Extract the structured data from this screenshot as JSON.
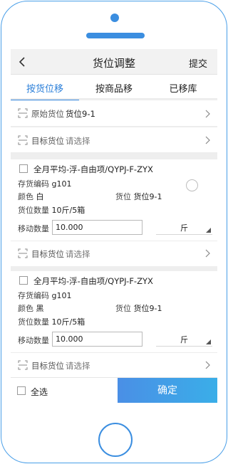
{
  "navbar": {
    "title": "货位调整",
    "submit_label": "提交"
  },
  "tabs": [
    {
      "label": "按货位移",
      "active": true
    },
    {
      "label": "按商品移",
      "active": false
    },
    {
      "label": "已移库",
      "active": false
    }
  ],
  "source_location": {
    "label": "原始货位",
    "value": "货位9-1"
  },
  "target_location": {
    "label": "目标货位",
    "placeholder": "请选择"
  },
  "items": [
    {
      "title": "全月平均-浮-自由项/QYPJ-F-ZYX",
      "code_label": "存货编码",
      "code_value": "g101",
      "color_label": "颜色",
      "color_value": "白",
      "location_label": "货位",
      "location_value": "货位9-1",
      "quantity_label": "货位数量",
      "quantity_value": "10斤/5箱",
      "move_qty_label": "移动数量",
      "move_qty_value": "10.000",
      "unit": "斤",
      "target_label": "目标货位",
      "target_placeholder": "请选择"
    },
    {
      "title": "全月平均-浮-自由项/QYPJ-F-ZYX",
      "code_label": "存货编码",
      "code_value": "g101",
      "color_label": "颜色",
      "color_value": "黑",
      "location_label": "货位",
      "location_value": "货位9-1",
      "quantity_label": "货位数量",
      "quantity_value": "10斤/5箱",
      "move_qty_label": "移动数量",
      "move_qty_value": "10.000",
      "unit": "斤",
      "target_label": "目标货位",
      "target_placeholder": "请选择"
    }
  ],
  "bottom": {
    "select_all_label": "全选",
    "confirm_label": "确定"
  },
  "colors": {
    "accent": "#2b7fd9",
    "frame": "#3b8ee0"
  },
  "icons": [
    "back-arrow-icon",
    "scan-icon",
    "chevron-right-icon"
  ]
}
